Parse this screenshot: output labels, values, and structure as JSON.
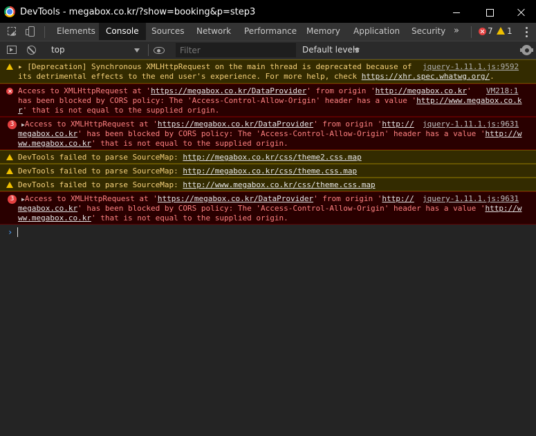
{
  "window": {
    "title": "DevTools - megabox.co.kr/?show=booking&p=step3"
  },
  "tabs": [
    {
      "label": "Elements"
    },
    {
      "label": "Console"
    },
    {
      "label": "Sources"
    },
    {
      "label": "Network"
    },
    {
      "label": "Performance"
    },
    {
      "label": "Memory"
    },
    {
      "label": "Application"
    },
    {
      "label": "Security"
    }
  ],
  "more_tabs": "»",
  "counts": {
    "errors": "7",
    "warnings": "1"
  },
  "toolbar": {
    "context": "top",
    "filter_placeholder": "Filter",
    "levels": "Default levels"
  },
  "messages": [
    {
      "level": "warning",
      "lines": [
        "▸ [Deprecation] Synchronous XMLHttpRequest on the main thread is deprecated because of",
        "its detrimental effects to the end user's experience. For more help, check ",
        "https://xhr.spec.whatwg.org/",
        "."
      ],
      "source": "jquery-1.11.1.js:9592"
    },
    {
      "level": "error",
      "l1a": "Access to XMLHttpRequest at '",
      "l1url": "https://megabox.co.kr/DataProvider",
      "l1b": "' from origin '",
      "l1origin": "http://megabox.co.kr",
      "l1c": "'",
      "l2a": "has been blocked by CORS policy: The 'Access-Control-Allow-Origin' header has a value '",
      "l2url": "http://www.megabox.co.k",
      "l3url": "r",
      "l3b": "' that is not equal to the supplied origin.",
      "source": "VM218:1"
    },
    {
      "level": "error",
      "count": "3",
      "l1a": "Access to XMLHttpRequest at '",
      "l1url": "https://megabox.co.kr/DataProvider",
      "l1b": "' from origin '",
      "l1origin": "http://",
      "l2origin": "megabox.co.kr",
      "l2a": "' has been blocked by CORS policy: The 'Access-Control-Allow-Origin' header has a value '",
      "l2url": "http://w",
      "l3url": "ww.megabox.co.kr",
      "l3b": "' that is not equal to the supplied origin.",
      "source": "jquery-1.11.1.js:9631"
    },
    {
      "level": "warning",
      "text": "DevTools failed to parse SourceMap: ",
      "url": "http://megabox.co.kr/css/theme2.css.map"
    },
    {
      "level": "warning",
      "text": "DevTools failed to parse SourceMap: ",
      "url": "http://megabox.co.kr/css/theme.css.map"
    },
    {
      "level": "warning",
      "text": "DevTools failed to parse SourceMap: ",
      "url": "http://www.megabox.co.kr/css/theme.css.map"
    },
    {
      "level": "error",
      "count": "3",
      "l1a": "Access to XMLHttpRequest at '",
      "l1url": "https://megabox.co.kr/DataProvider",
      "l1b": "' from origin '",
      "l1origin": "http://",
      "l2origin": "megabox.co.kr",
      "l2a": "' has been blocked by CORS policy: The 'Access-Control-Allow-Origin' header has a value '",
      "l2url": "http://w",
      "l3url": "ww.megabox.co.kr",
      "l3b": "' that is not equal to the supplied origin.",
      "source": "jquery-1.11.1.js:9631"
    }
  ],
  "prompt": "›",
  "colors": {
    "warning_bg": "#332b00",
    "error_bg": "#290000",
    "warning_text": "#f5d07a",
    "error_text": "#ff8080",
    "accent": "#4da3ff"
  }
}
